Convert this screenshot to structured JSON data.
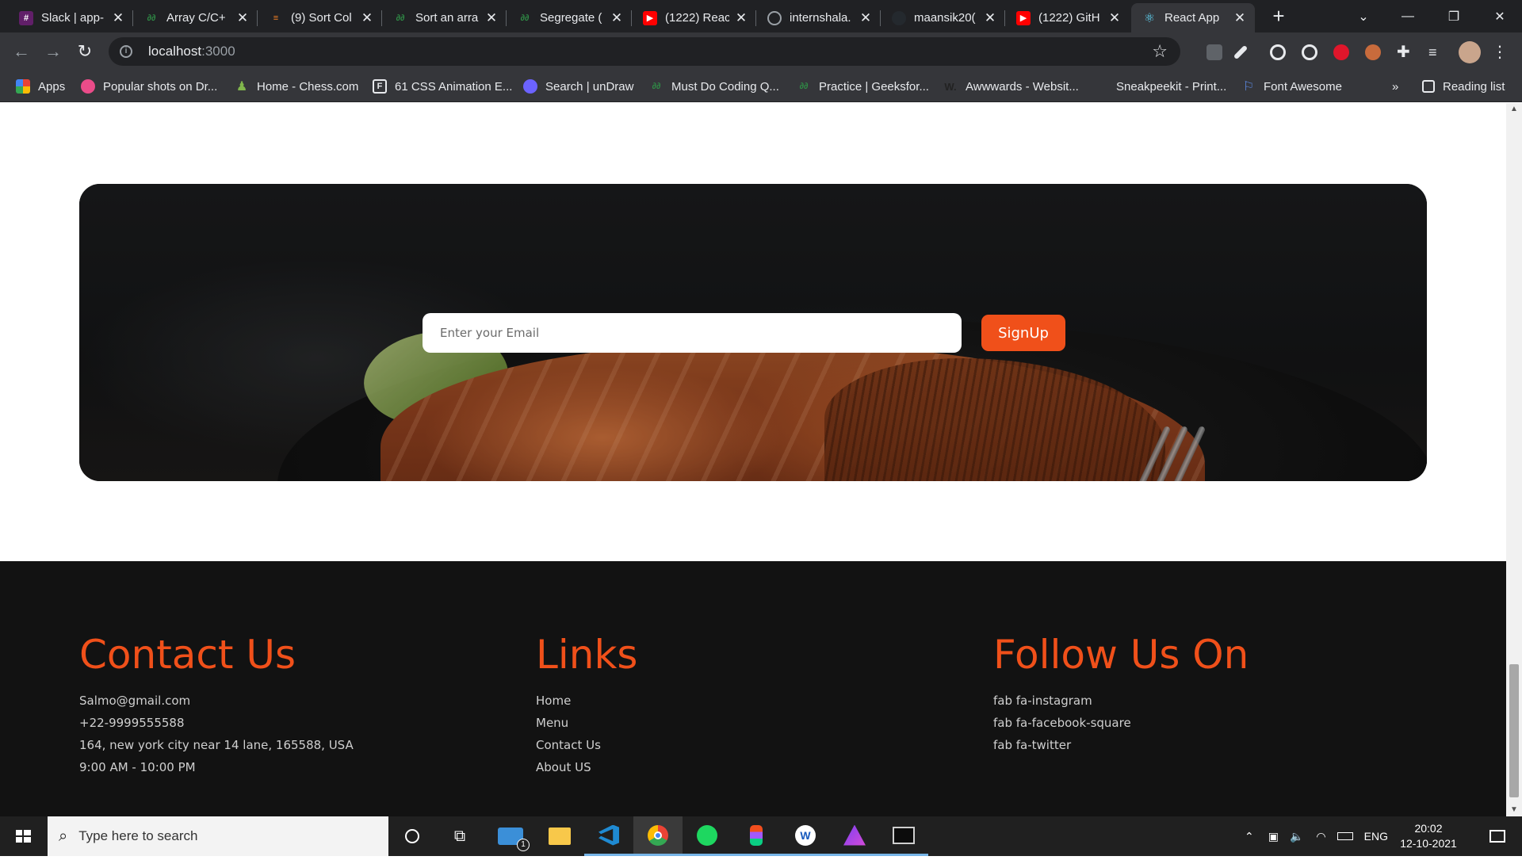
{
  "browser": {
    "tabs": [
      {
        "label": "Slack | app-",
        "favicon": "slack-icon",
        "color": "#611f69"
      },
      {
        "label": "Array C/C+",
        "favicon": "gfg-icon",
        "color": "#2f8d46"
      },
      {
        "label": "(9) Sort Col",
        "favicon": "stackoverflow-icon",
        "color": "#f48024"
      },
      {
        "label": "Sort an arra",
        "favicon": "gfg-icon",
        "color": "#2f8d46"
      },
      {
        "label": "Segregate (",
        "favicon": "gfg-icon",
        "color": "#2f8d46"
      },
      {
        "label": "(1222) Reac",
        "favicon": "youtube-icon",
        "color": "#ff0000"
      },
      {
        "label": "internshala.",
        "favicon": "globe-icon",
        "color": "#9aa0a6"
      },
      {
        "label": "maansik20(",
        "favicon": "github-icon",
        "color": "#24292e"
      },
      {
        "label": "(1222) GitH",
        "favicon": "youtube-icon",
        "color": "#ff0000"
      },
      {
        "label": "React App",
        "favicon": "react-icon",
        "color": "#61dafb",
        "active": true
      }
    ],
    "url_host": "localhost",
    "url_port": ":3000",
    "bookmarks": [
      {
        "label": "Apps",
        "icon": "apps-grid-icon"
      },
      {
        "label": "Popular shots on Dr...",
        "icon": "dribbble-icon"
      },
      {
        "label": "Home - Chess.com",
        "icon": "chess-icon"
      },
      {
        "label": "61 CSS Animation E...",
        "icon": "f-icon"
      },
      {
        "label": "Search | unDraw",
        "icon": "undraw-icon"
      },
      {
        "label": "Must Do Coding Q...",
        "icon": "gfg-icon"
      },
      {
        "label": "Practice | Geeksfor...",
        "icon": "gfg-icon"
      },
      {
        "label": "Awwwards - Websit...",
        "icon": "awwwards-icon"
      },
      {
        "label": "Sneakpeekit - Print...",
        "icon": "blank-icon"
      },
      {
        "label": "Font Awesome",
        "icon": "flag-icon"
      },
      {
        "label": "»",
        "icon": ""
      },
      {
        "label": "Reading list",
        "icon": "reading-list-icon"
      }
    ]
  },
  "newsletter": {
    "email_placeholder": "Enter your Email",
    "signup_label": "SignUp"
  },
  "footer": {
    "contact": {
      "title": "Contact Us",
      "items": [
        "Salmo@gmail.com",
        "+22-9999555588",
        "164, new york city near 14 lane, 165588, USA",
        "9:00 AM - 10:00 PM"
      ]
    },
    "links": {
      "title": "Links",
      "items": [
        "Home",
        "Menu",
        "Contact Us",
        "About US"
      ]
    },
    "follow": {
      "title": "Follow Us On",
      "items": [
        "fab fa-instagram",
        "fab fa-facebook-square",
        "fab fa-twitter"
      ]
    }
  },
  "taskbar": {
    "search_placeholder": "Type here to search",
    "language": "ENG",
    "time": "20:02",
    "date": "12-10-2021",
    "mail_badge": "1"
  },
  "colors": {
    "accent": "#f0501a",
    "footer_bg": "#121212",
    "chrome_dark": "#202124"
  }
}
